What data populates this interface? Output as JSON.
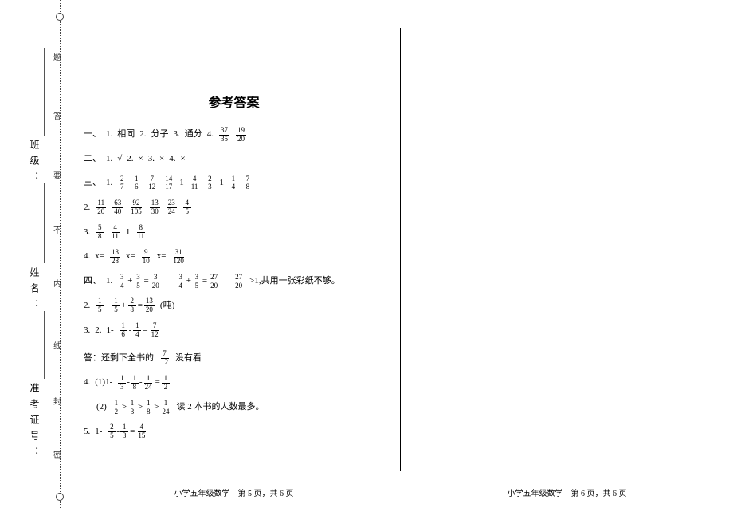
{
  "title": "参考答案",
  "sidebar": {
    "field1": "班级：",
    "field2": "姓名：",
    "field3": "准考证号：",
    "chars": [
      "题",
      "答",
      "要",
      "不",
      "内",
      "线",
      "封",
      "密"
    ]
  },
  "sec1": {
    "prefix": "一、",
    "items": [
      {
        "n": "1.",
        "t": "相同"
      },
      {
        "n": "2.",
        "t": "分子"
      },
      {
        "n": "3.",
        "t": "通分"
      },
      {
        "n": "4.",
        "t": ""
      }
    ],
    "f1": {
      "n": "37",
      "d": "35"
    },
    "f2": {
      "n": "19",
      "d": "20"
    }
  },
  "sec2": {
    "prefix": "二、",
    "items": [
      {
        "n": "1.",
        "t": "√"
      },
      {
        "n": "2.",
        "t": "×"
      },
      {
        "n": "3.",
        "t": "×"
      },
      {
        "n": "4.",
        "t": "×"
      }
    ]
  },
  "sec3": {
    "prefix": "三、",
    "row1": {
      "lead": "1.",
      "fracs": [
        {
          "n": "2",
          "d": "7"
        },
        {
          "n": "1",
          "d": "6"
        },
        {
          "n": "7",
          "d": "12"
        },
        {
          "n": "14",
          "d": "17"
        }
      ],
      "mixed1": {
        "w": "1",
        "n": "4",
        "d": "11"
      },
      "frac5": {
        "n": "2",
        "d": "3"
      },
      "mixed2": {
        "w": "1",
        "n": "1",
        "d": "4"
      },
      "frac6": {
        "n": "7",
        "d": "8"
      }
    },
    "row2": {
      "lead": "2.",
      "fracs": [
        {
          "n": "11",
          "d": "20"
        },
        {
          "n": "63",
          "d": "40"
        },
        {
          "n": "92",
          "d": "105"
        },
        {
          "n": "13",
          "d": "30"
        },
        {
          "n": "23",
          "d": "24"
        },
        {
          "n": "4",
          "d": "5"
        }
      ]
    },
    "row3": {
      "lead": "3.",
      "fracs": [
        {
          "n": "5",
          "d": "8"
        },
        {
          "n": "4",
          "d": "11"
        }
      ],
      "one": "1",
      "frac3": {
        "n": "8",
        "d": "11"
      }
    },
    "row4": {
      "lead": "4.",
      "eq1": {
        "pre": "x=",
        "n": "13",
        "d": "28"
      },
      "eq2": {
        "pre": "x=",
        "n": "9",
        "d": "10"
      },
      "eq3": {
        "pre": "x=",
        "n": "31",
        "d": "120"
      }
    }
  },
  "sec4": {
    "prefix": "四、",
    "row1": {
      "lead": "1.",
      "f1": {
        "n": "3",
        "d": "4"
      },
      "plus1": "+",
      "f2": {
        "n": "3",
        "d": "5"
      },
      "eq1": "=",
      "f3": {
        "n": "3",
        "d": "20"
      },
      "gap": "",
      "f4": {
        "n": "3",
        "d": "4"
      },
      "plus2": "+",
      "f5": {
        "n": "3",
        "d": "5"
      },
      "eq2": "=",
      "f6": {
        "n": "27",
        "d": "20"
      },
      "tail1": ">1,共用一张彩纸不够。",
      "f7": {
        "n": "27",
        "d": "20"
      }
    },
    "row2": {
      "lead": "2.",
      "f1": {
        "n": "1",
        "d": "5"
      },
      "plus1": "+",
      "f2": {
        "n": "1",
        "d": "5"
      },
      "plus2": "+",
      "f3": {
        "n": "2",
        "d": "8"
      },
      "eq": "=",
      "f4": {
        "n": "13",
        "d": "20"
      },
      "tail": "(吨)"
    },
    "row3": {
      "lead": "3.",
      "two": "2.",
      "one": "1-",
      "f1": {
        "n": "1",
        "d": "6"
      },
      "minus": "-",
      "f2": {
        "n": "1",
        "d": "4"
      },
      "eq": "=",
      "f3": {
        "n": "7",
        "d": "12"
      }
    },
    "row3ans": {
      "pre": "答：还剩下全书的",
      "f1": {
        "n": "7",
        "d": "12"
      },
      "post": "没有看"
    },
    "row4": {
      "lead": "4.",
      "p1": "(1)1-",
      "f1": {
        "n": "1",
        "d": "3"
      },
      "f2": {
        "n": "1",
        "d": "8"
      },
      "f3": {
        "n": "1",
        "d": "24"
      },
      "eq": "=",
      "f4": {
        "n": "1",
        "d": "2"
      }
    },
    "row4b": {
      "p2": "(2)",
      "f1": {
        "n": "1",
        "d": "2"
      },
      "gt1": ">",
      "f2": {
        "n": "1",
        "d": "3"
      },
      "gt2": ">",
      "f3": {
        "n": "1",
        "d": "8"
      },
      "gt3": ">",
      "f4": {
        "n": "1",
        "d": "24"
      },
      "tail": "读 2 本书的人数最多。"
    },
    "row5": {
      "lead": "5.",
      "one": "1-",
      "f1": {
        "n": "2",
        "d": "5"
      },
      "f2": {
        "n": "1",
        "d": "3"
      },
      "eq": "=",
      "f3": {
        "n": "4",
        "d": "15"
      }
    }
  },
  "footer": {
    "left": "小学五年级数学　第 5 页，共 6 页",
    "right": "小学五年级数学　第 6 页，共 6 页"
  }
}
